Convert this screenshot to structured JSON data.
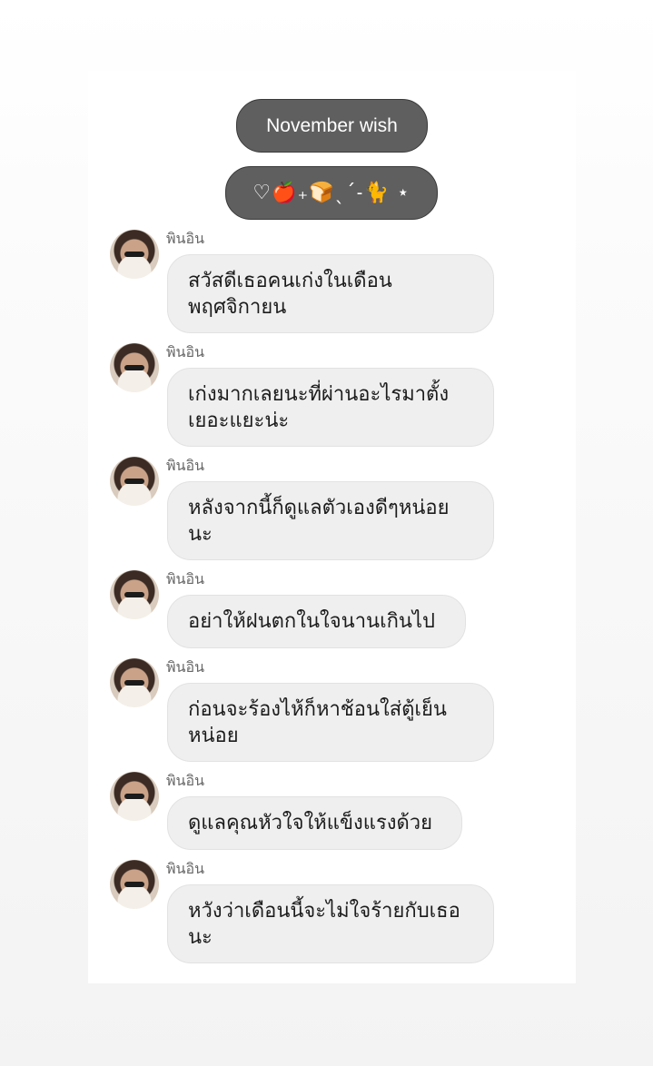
{
  "header": {
    "title": "November wish",
    "emoji_line": "♡🍎₊🍞ˎˊ˗🐈 ⋆"
  },
  "messages": [
    {
      "sender": "พินอิน",
      "text": "สวัสดีเธอคนเก่งในเดือนพฤศจิกายน"
    },
    {
      "sender": "พินอิน",
      "text": "เก่งมากเลยนะที่ผ่านอะไรมาตั้งเยอะแยะน่ะ"
    },
    {
      "sender": "พินอิน",
      "text": "หลังจากนี้ก็ดูแลตัวเองดีๆหน่อยนะ"
    },
    {
      "sender": "พินอิน",
      "text": "อย่าให้ฝนตกในใจนานเกินไป"
    },
    {
      "sender": "พินอิน",
      "text": "ก่อนจะร้องไห้ก็หาช้อนใส่ตู้เย็นหน่อย"
    },
    {
      "sender": "พินอิน",
      "text": "ดูแลคุณหัวใจให้แข็งแรงด้วย"
    },
    {
      "sender": "พินอิน",
      "text": "หวังว่าเดือนนี้จะไม่ใจร้ายกับเธอนะ"
    }
  ]
}
